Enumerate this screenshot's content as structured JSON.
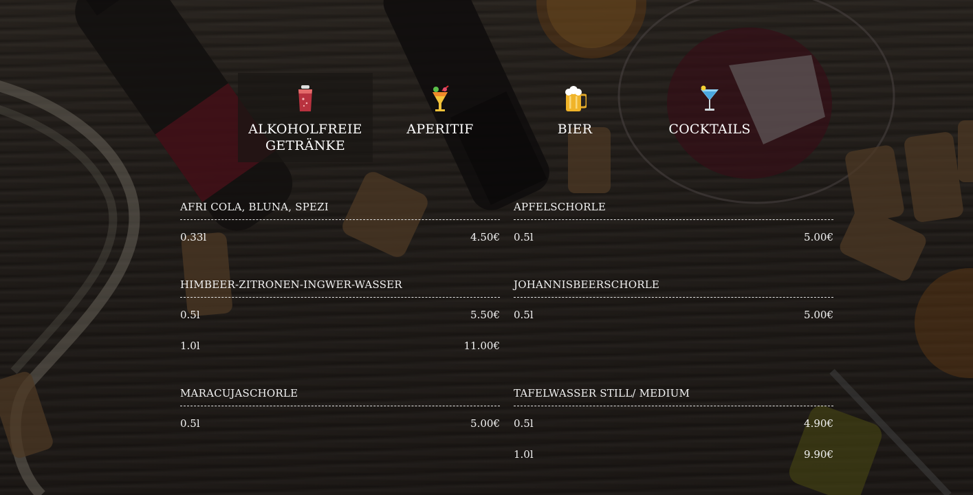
{
  "tabs": [
    {
      "label": "ALKOHOLFREIE\nGETRÄNKE",
      "icon": "soft-drink-icon",
      "active": true
    },
    {
      "label": "APERITIF",
      "icon": "tropical-drink-icon",
      "active": false
    },
    {
      "label": "BIER",
      "icon": "beer-mug-icon",
      "active": false
    },
    {
      "label": "COCKTAILS",
      "icon": "cocktail-glass-icon",
      "active": false
    }
  ],
  "menu": {
    "left": [
      {
        "name": "AFRI COLA, BLUNA, SPEZI",
        "prices": [
          {
            "size": "0.33l",
            "price": "4.50€"
          }
        ]
      },
      {
        "name": "HIMBEER-ZITRONEN-INGWER-WASSER",
        "prices": [
          {
            "size": "0.5l",
            "price": "5.50€"
          },
          {
            "size": "1.0l",
            "price": "11.00€"
          }
        ]
      },
      {
        "name": "MARACUJASCHORLE",
        "prices": [
          {
            "size": "0.5l",
            "price": "5.00€"
          }
        ]
      }
    ],
    "right": [
      {
        "name": "APFELSCHORLE",
        "prices": [
          {
            "size": "0.5l",
            "price": "5.00€"
          }
        ]
      },
      {
        "name": "JOHANNISBEERSCHORLE",
        "prices": [
          {
            "size": "0.5l",
            "price": "5.00€"
          }
        ]
      },
      {
        "name": "TAFELWASSER STILL/ MEDIUM",
        "prices": [
          {
            "size": "0.5l",
            "price": "4.90€"
          },
          {
            "size": "1.0l",
            "price": "9.90€"
          }
        ]
      }
    ]
  }
}
